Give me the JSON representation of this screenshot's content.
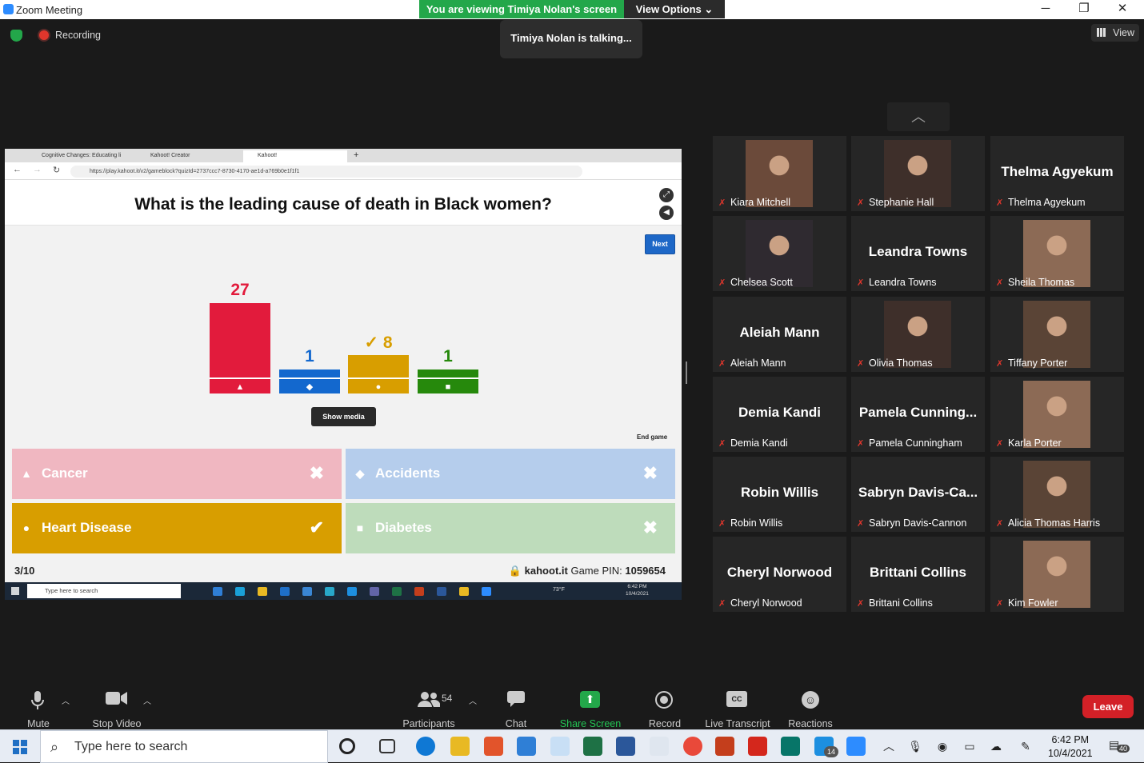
{
  "window": {
    "title": "Zoom Meeting",
    "viewing_banner": "You are viewing Timiya Nolan's screen",
    "view_options": "View Options",
    "minimize": "─",
    "maximize": "❐",
    "close": "✕"
  },
  "top": {
    "recording": "Recording",
    "talking": "Timiya Nolan is talking...",
    "view": "View"
  },
  "browser": {
    "tabs": [
      "Cognitive Changes: Educating li",
      "Kahoot! Creator",
      "Kahoot!"
    ],
    "url": "https://play.kahoot.it/v2/gameblock?quizId=2737ccc7-8730-4170-ae1d-a769b0e1f1f1"
  },
  "kahoot": {
    "question": "What is the leading cause of death in Black women?",
    "next": "Next",
    "show_media": "Show media",
    "end_game": "End game",
    "progress": "3/10",
    "site": "kahoot.it",
    "pin_label": "Game PIN:",
    "pin": "1059654",
    "results": [
      {
        "count": "27",
        "value": 27,
        "color": "#e21b3c",
        "shape": "▲",
        "correct": false
      },
      {
        "count": "1",
        "value": 1,
        "color": "#1368ce",
        "shape": "◆",
        "correct": false
      },
      {
        "count": "8",
        "value": 8,
        "color": "#d89e00",
        "shape": "●",
        "correct": true
      },
      {
        "count": "1",
        "value": 1,
        "color": "#26890c",
        "shape": "■",
        "correct": false
      }
    ],
    "correct_mark": "✓",
    "answers": [
      {
        "label": "Cancer",
        "shape": "▲",
        "mark": "✖",
        "color": "#f0b7c1"
      },
      {
        "label": "Accidents",
        "shape": "◆",
        "mark": "✖",
        "color": "#b5cdec"
      },
      {
        "label": "Heart Disease",
        "shape": "●",
        "mark": "✔",
        "color": "#d89e00"
      },
      {
        "label": "Diabetes",
        "shape": "■",
        "mark": "✖",
        "color": "#bedcbb"
      }
    ],
    "inner_taskbar": {
      "search": "Type here to search",
      "weather": "73°F",
      "time": "6:42 PM",
      "date": "10/4/2021"
    }
  },
  "gallery": {
    "participants": [
      {
        "name": "Kiara Mitchell",
        "big": "",
        "photo": true
      },
      {
        "name": "Stephanie Hall",
        "big": "",
        "photo": true
      },
      {
        "name": "Thelma Agyekum",
        "big": "Thelma Agyekum",
        "photo": false
      },
      {
        "name": "Chelsea Scott",
        "big": "",
        "photo": true
      },
      {
        "name": "Leandra Towns",
        "big": "Leandra Towns",
        "photo": false
      },
      {
        "name": "Sheila Thomas",
        "big": "",
        "photo": true
      },
      {
        "name": "Aleiah Mann",
        "big": "Aleiah Mann",
        "photo": false
      },
      {
        "name": "Olivia Thomas",
        "big": "",
        "photo": true
      },
      {
        "name": "Tiffany Porter",
        "big": "",
        "photo": true
      },
      {
        "name": "Demia Kandi",
        "big": "Demia Kandi",
        "photo": false
      },
      {
        "name": "Pamela Cunningham",
        "big": "Pamela Cunning...",
        "photo": false
      },
      {
        "name": "Karla Porter",
        "big": "",
        "photo": true
      },
      {
        "name": "Robin Willis",
        "big": "Robin Willis",
        "photo": false
      },
      {
        "name": "Sabryn Davis-Cannon",
        "big": "Sabryn Davis-Ca...",
        "photo": false
      },
      {
        "name": "Alicia Thomas Harris",
        "big": "",
        "photo": true
      },
      {
        "name": "Cheryl Norwood",
        "big": "Cheryl Norwood",
        "photo": false
      },
      {
        "name": "Brittani Collins",
        "big": "Brittani Collins",
        "photo": false
      },
      {
        "name": "Kim Fowler",
        "big": "",
        "photo": true
      }
    ]
  },
  "toolbar": {
    "mute": "Mute",
    "stop_video": "Stop Video",
    "participants": "Participants",
    "participant_count": "54",
    "chat": "Chat",
    "share_screen": "Share Screen",
    "record": "Record",
    "live_transcript": "Live Transcript",
    "reactions": "Reactions",
    "leave": "Leave",
    "cc": "CC"
  },
  "taskbar": {
    "search": "Type here to search",
    "time": "6:42 PM",
    "date": "10/4/2021",
    "notifications": "40",
    "badge": "14"
  }
}
